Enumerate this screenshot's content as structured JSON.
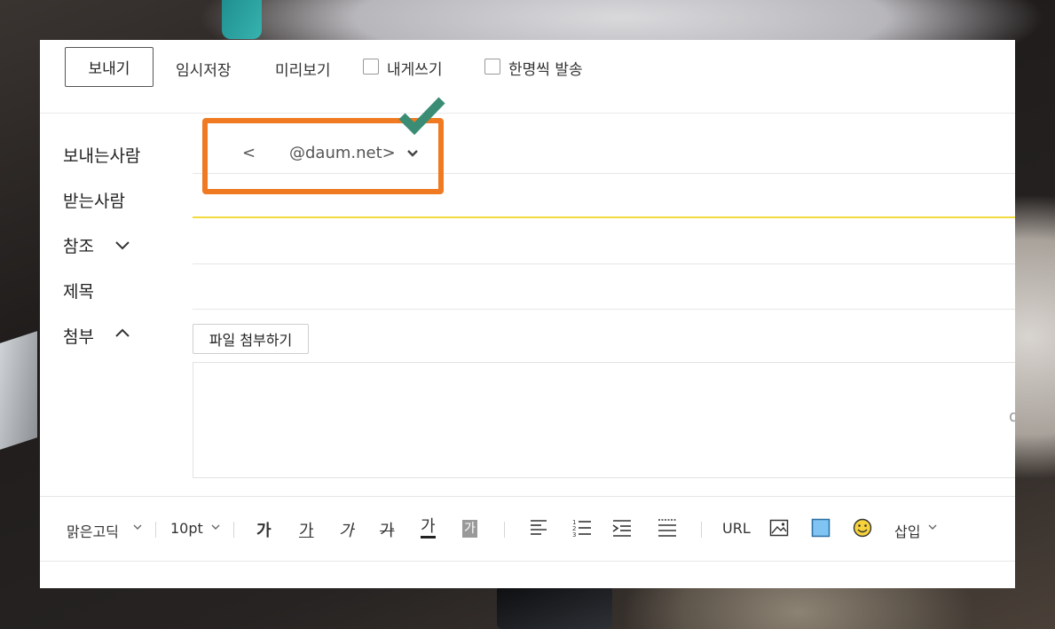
{
  "toolbar": {
    "send_label": "보내기",
    "draft_label": "임시저장",
    "preview_label": "미리보기",
    "to_me_label": "내게쓰기",
    "individual_send_label": "한명씩 발송"
  },
  "fields": {
    "sender_label": "보내는사람",
    "recipient_label": "받는사람",
    "cc_label": "참조",
    "subject_label": "제목",
    "attach_label": "첨부",
    "sender_prefix": "<",
    "sender_email": "@daum.net>"
  },
  "attachment": {
    "button_label": "파일 첨부하기",
    "hint": "d"
  },
  "editor": {
    "font": "맑은고딕",
    "size": "10pt",
    "bold": "가",
    "underline": "가",
    "italic": "가",
    "strike": "가",
    "text_color": "가",
    "bg_color": "가",
    "url": "URL",
    "insert": "삽입"
  },
  "colors": {
    "highlight": "#f07a22",
    "checkmark": "#3a8d74",
    "focus_line": "#f2db3e",
    "image_box": "#7fc4f2"
  }
}
